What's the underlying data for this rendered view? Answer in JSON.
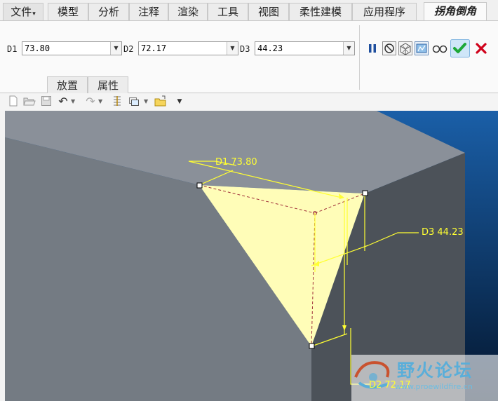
{
  "tabs": [
    {
      "label": "文件",
      "has_dropdown": true
    },
    {
      "label": "模型"
    },
    {
      "label": "分析"
    },
    {
      "label": "注释"
    },
    {
      "label": "渲染"
    },
    {
      "label": "工具"
    },
    {
      "label": "视图"
    },
    {
      "label": "柔性建模"
    },
    {
      "label": "应用程序"
    },
    {
      "label": "拐角倒角",
      "active": true
    }
  ],
  "dimensions": {
    "d1": {
      "label": "D1",
      "value": "73.80"
    },
    "d2": {
      "label": "D2",
      "value": "72.17"
    },
    "d3": {
      "label": "D3",
      "value": "44.23"
    }
  },
  "subtabs": {
    "placement": "放置",
    "properties": "属性"
  },
  "action_icons": [
    "pause-icon",
    "no-preview-icon",
    "geometry-preview-icon",
    "verify-preview-icon",
    "glasses-icon",
    "ok-check-icon",
    "cancel-x-icon"
  ],
  "toolbar_icons": [
    "new-file-icon",
    "open-icon",
    "save-icon",
    "undo-icon",
    "redo-icon",
    "regenerate-icon",
    "windows-icon",
    "close-window-icon",
    "customize-icon"
  ],
  "model_labels": {
    "d1": "D1 73.80",
    "d2": "D2 72.17",
    "d3": "D3 44.23"
  },
  "watermark": {
    "title": "野火论坛",
    "url": "www.proewildfire.cn"
  },
  "colors": {
    "viewport_top": "#1a5fa8",
    "viewport_bottom": "#04162e",
    "top_face": "#8a9099",
    "front_face": "#747b83",
    "right_face": "#4c5259",
    "chamfer_fill": "#fffdb8",
    "annotation": "#ffff33",
    "ok_green": "#1ea838",
    "cancel_red": "#d0021b"
  }
}
